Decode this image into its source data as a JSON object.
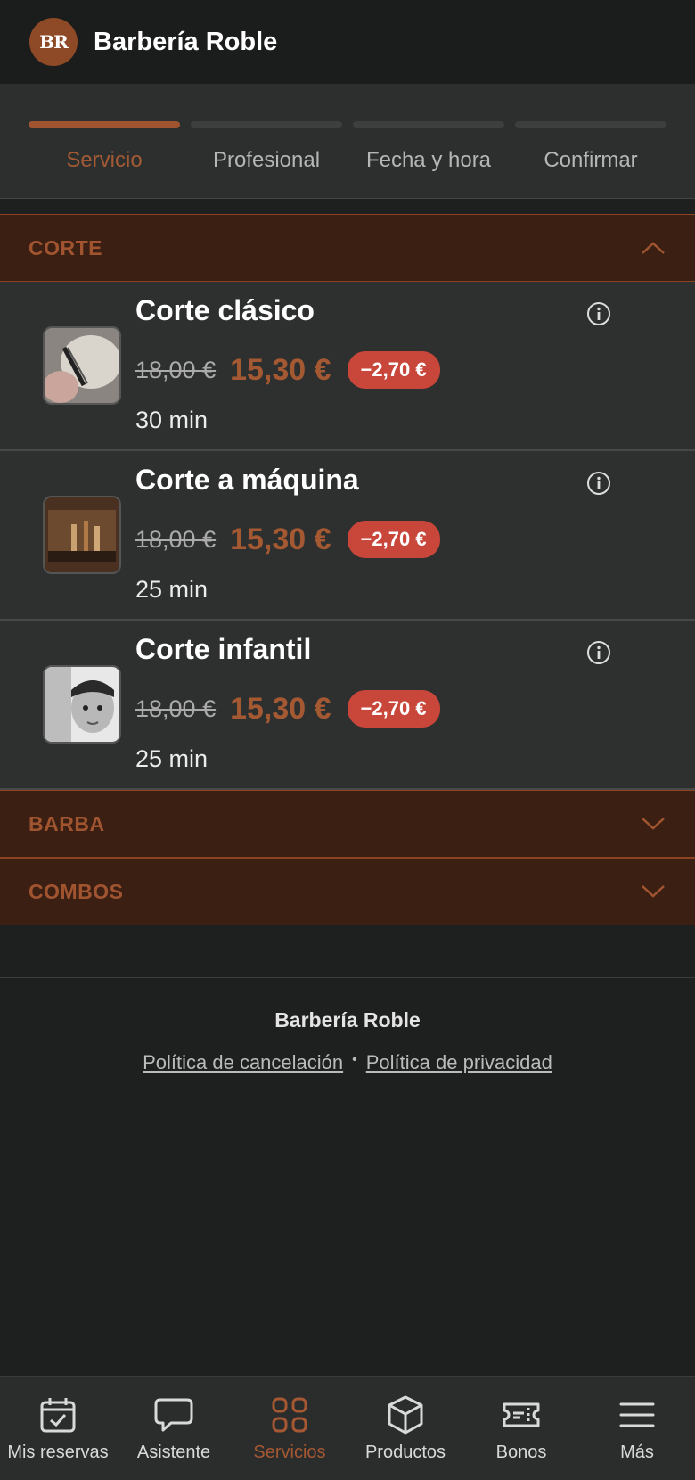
{
  "header": {
    "logo_text": "BR",
    "brand": "Barbería Roble"
  },
  "steps": [
    {
      "label": "Servicio",
      "active": true
    },
    {
      "label": "Profesional",
      "active": false
    },
    {
      "label": "Fecha y hora",
      "active": false
    },
    {
      "label": "Confirmar",
      "active": false
    }
  ],
  "sections": [
    {
      "title": "CORTE",
      "expanded": true,
      "services": [
        {
          "name": "Corte clásico",
          "old_price": "18,00 €",
          "price": "15,30 €",
          "discount": "−2,70 €",
          "duration": "30 min",
          "thumb_icon": "scissors-photo-icon"
        },
        {
          "name": "Corte a máquina",
          "old_price": "18,00 €",
          "price": "15,30 €",
          "discount": "−2,70 €",
          "duration": "25 min",
          "thumb_icon": "clipper-photo-icon"
        },
        {
          "name": "Corte infantil",
          "old_price": "18,00 €",
          "price": "15,30 €",
          "discount": "−2,70 €",
          "duration": "25 min",
          "thumb_icon": "child-photo-icon"
        }
      ]
    },
    {
      "title": "BARBA",
      "expanded": false,
      "services": []
    },
    {
      "title": "COMBOS",
      "expanded": false,
      "services": []
    }
  ],
  "footer": {
    "name": "Barbería Roble",
    "cancel_policy": "Política de cancelación",
    "separator": "•",
    "privacy_policy": "Política de privacidad"
  },
  "bottom_nav": [
    {
      "label": "Mis reservas",
      "icon": "calendar-icon",
      "active": false
    },
    {
      "label": "Asistente",
      "icon": "chat-bubble-icon",
      "active": false
    },
    {
      "label": "Servicios",
      "icon": "grid-icon",
      "active": true
    },
    {
      "label": "Productos",
      "icon": "box-icon",
      "active": false
    },
    {
      "label": "Bonos",
      "icon": "ticket-icon",
      "active": false
    },
    {
      "label": "Más",
      "icon": "menu-icon",
      "active": false
    }
  ],
  "colors": {
    "accent": "#a15430",
    "section_bg": "#3b1f12",
    "discount_badge": "#c8473a",
    "background": "#1e1f1f"
  }
}
